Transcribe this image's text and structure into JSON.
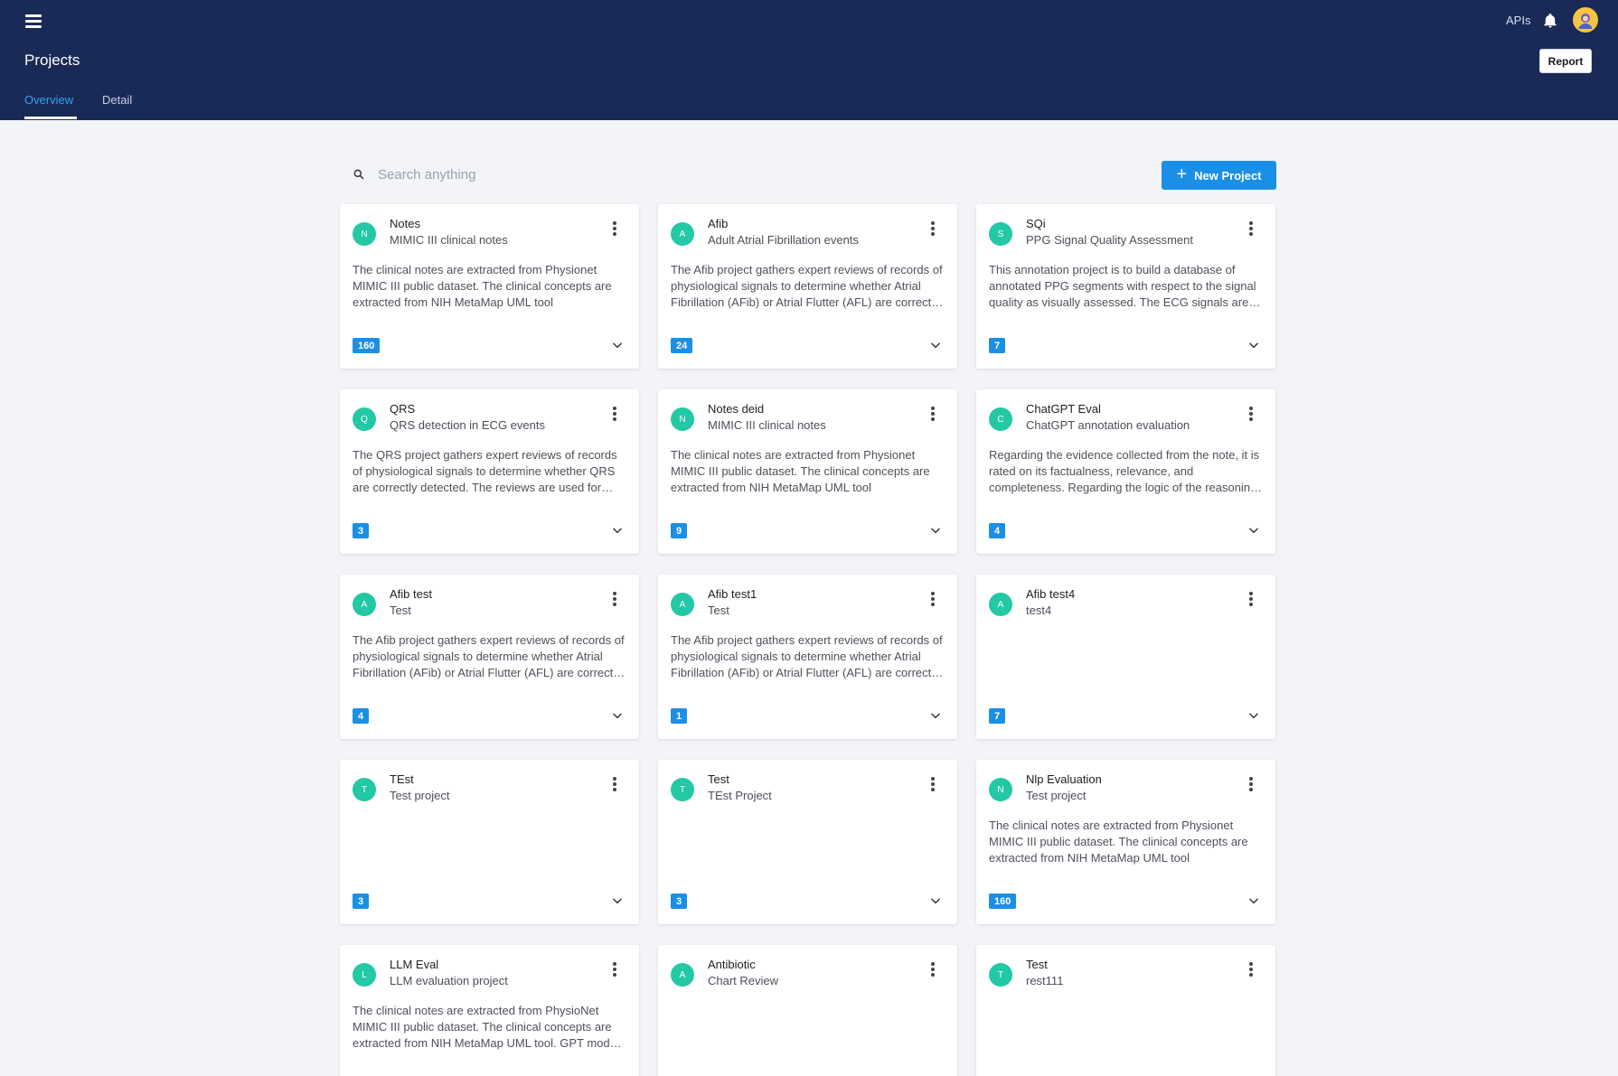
{
  "header": {
    "apis_label": "APIs",
    "page_title": "Projects",
    "report_label": "Report",
    "tabs": [
      {
        "label": "Overview",
        "active": true
      },
      {
        "label": "Detail",
        "active": false
      }
    ]
  },
  "toolbar": {
    "search_placeholder": "Search anything",
    "new_project_label": "New Project",
    "new_project_icon": "plus-icon"
  },
  "colors": {
    "header_bg": "#1a2a57",
    "accent": "#1b8fe6",
    "avatar_badge": "#23c8a5",
    "active_tab": "#2ea6ee"
  },
  "projects": [
    {
      "letter": "N",
      "title": "Notes",
      "subtitle": "MIMIC III clinical notes",
      "description": "The clinical notes are extracted from Physionet MIMIC III public dataset. The clinical concepts are extracted from NIH MetaMap UML tool",
      "count": "160"
    },
    {
      "letter": "A",
      "title": "Afib",
      "subtitle": "Adult Atrial Fibrillation events",
      "description": "The Afib project gathers expert reviews of records of physiological signals to determine whether Atrial Fibrillation (AFib) or Atrial Flutter (AFL) are correctly detected.",
      "count": "24"
    },
    {
      "letter": "S",
      "title": "SQi",
      "subtitle": "PPG Signal Quality Assessment",
      "description": "This annotation project is to build a database of annotated PPG segments with respect to the signal quality as visually assessed. The ECG signals are used as references.",
      "count": "7"
    },
    {
      "letter": "Q",
      "title": "QRS",
      "subtitle": "QRS detection in ECG events",
      "description": "The QRS project gathers expert reviews of records of physiological signals to determine whether QRS are correctly detected. The reviews are used for evaluation.",
      "count": "3"
    },
    {
      "letter": "N",
      "title": "Notes deid",
      "subtitle": "MIMIC III clinical notes",
      "description": "The clinical notes are extracted from Physionet MIMIC III public dataset. The clinical concepts are extracted from NIH MetaMap UML tool",
      "count": "9"
    },
    {
      "letter": "C",
      "title": "ChatGPT Eval",
      "subtitle": "ChatGPT annotation evaluation",
      "description": "Regarding the evidence collected from the note, it is rated on its factualness, relevance, and completeness. Regarding the logic of the reasoning, it is rated.",
      "count": "4"
    },
    {
      "letter": "A",
      "title": "Afib test",
      "subtitle": "Test",
      "description": "The Afib project gathers expert reviews of records of physiological signals to determine whether Atrial Fibrillation (AFib) or Atrial Flutter (AFL) are correctly detected.",
      "count": "4"
    },
    {
      "letter": "A",
      "title": "Afib test1",
      "subtitle": "Test",
      "description": "The Afib project gathers expert reviews of records of physiological signals to determine whether Atrial Fibrillation (AFib) or Atrial Flutter (AFL) are correctly detected.",
      "count": "1"
    },
    {
      "letter": "A",
      "title": "Afib test4",
      "subtitle": "test4",
      "description": "",
      "count": "7"
    },
    {
      "letter": "T",
      "title": "TEst",
      "subtitle": "Test project",
      "description": "",
      "count": "3"
    },
    {
      "letter": "T",
      "title": "Test",
      "subtitle": "TEst Project",
      "description": "",
      "count": "3"
    },
    {
      "letter": "N",
      "title": "Nlp Evaluation",
      "subtitle": "Test project",
      "description": "The clinical notes are extracted from Physionet MIMIC III public dataset. The clinical concepts are extracted from NIH MetaMap UML tool",
      "count": "160"
    },
    {
      "letter": "L",
      "title": "LLM Eval",
      "subtitle": "LLM evaluation project",
      "description": "The clinical notes are extracted from PhysioNet MIMIC III public dataset. The clinical concepts are extracted from NIH MetaMap UML tool. GPT models are used.",
      "count": ""
    },
    {
      "letter": "A",
      "title": "Antibiotic",
      "subtitle": "Chart Review",
      "description": "",
      "count": ""
    },
    {
      "letter": "T",
      "title": "Test",
      "subtitle": "rest111",
      "description": "",
      "count": ""
    }
  ]
}
